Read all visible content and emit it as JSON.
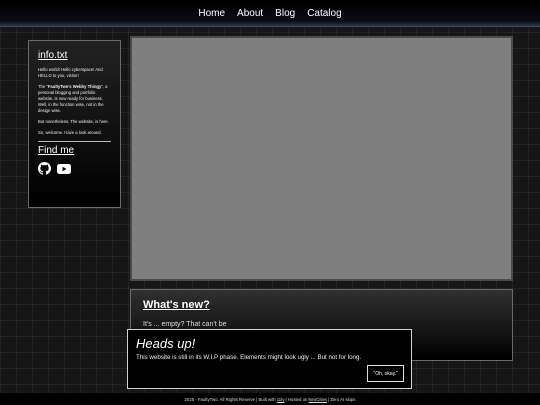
{
  "nav": {
    "items": [
      {
        "label": "Home"
      },
      {
        "label": "About"
      },
      {
        "label": "Blog"
      },
      {
        "label": "Catalog"
      }
    ]
  },
  "sidebar": {
    "title": "info.txt",
    "p1": "Hello world! Hello cyberspace! And HELLO to you, visitor!",
    "p2_before": "The \"",
    "p2_bold": "FaultyTwo's Webby Thingy",
    "p2_after": "\", a personal blogging and portfolio website, is now ready for business. Well, in the function wise, not in the design wise.",
    "p3": "But nonetheless. The website, is here.",
    "p4": "So, welcome. Have a look around.",
    "find_me": "Find me",
    "icons": [
      "github-icon",
      "youtube-icon"
    ]
  },
  "whatsnew": {
    "title": "What's new?",
    "text": "It's ... empty? That can't be"
  },
  "modal": {
    "title": "Heads up!",
    "text": "This website is still in its W.I.P phase. Elements might look ugly ... But not for long.",
    "button": "\"Oh, okay.\""
  },
  "footer": {
    "copyright": "2025 - FaultyTwo, All Rights Reserve | Built with",
    "eleventy": "11ty",
    "hosted": "| Hosted on",
    "neocities": "NeoCities",
    "ai": "| Zero AI slops"
  }
}
